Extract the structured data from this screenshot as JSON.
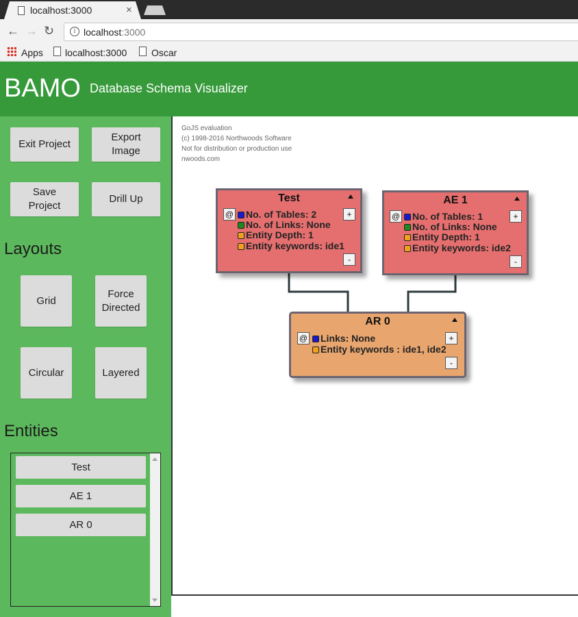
{
  "browser": {
    "tab_title": "localhost:3000",
    "tab_close": "×",
    "url_host": "localhost",
    "url_port": ":3000",
    "bookmarks": [
      "Apps",
      "localhost:3000",
      "Oscar"
    ]
  },
  "header": {
    "brand": "BAMO",
    "subtitle": "Database Schema Visualizer"
  },
  "sidebar": {
    "exit_project": "Exit Project",
    "export_image": "Export Image",
    "save_project": "Save Project",
    "drill_up": "Drill Up",
    "layouts_title": "Layouts",
    "layouts": [
      "Grid",
      "Force Directed",
      "Circular",
      "Layered"
    ],
    "entities_title": "Entities",
    "entities": [
      "Test",
      "AE 1",
      "AR 0"
    ]
  },
  "watermark": [
    "GoJS evaluation",
    "(c) 1998-2016 Northwoods Software",
    "Not for distribution or production use",
    "nwoods.com"
  ],
  "nodes": {
    "test": {
      "title": "Test",
      "rows": [
        "No. of Tables: 2",
        "No. of Links: None",
        "Entity Depth: 1",
        "Entity keywords: ide1"
      ]
    },
    "ae1": {
      "title": "AE 1",
      "rows": [
        "No. of Tables: 1",
        "No. of Links: None",
        "Entity Depth: 1",
        "Entity keywords: ide2"
      ]
    },
    "ar0": {
      "title": "AR 0",
      "rows": [
        "Links: None",
        "Entity keywords : ide1, ide2"
      ]
    },
    "at_label": "@",
    "plus_label": "+",
    "minus_label": "-"
  },
  "colors": {
    "header_green": "#369a3a",
    "sidebar_green": "#5cb85c",
    "node_red": "#e56f6f",
    "node_orange": "#e8a56e",
    "cube_blue": "#1a1acc",
    "cube_green": "#1e8a1e",
    "cube_orange": "#f0a020"
  }
}
